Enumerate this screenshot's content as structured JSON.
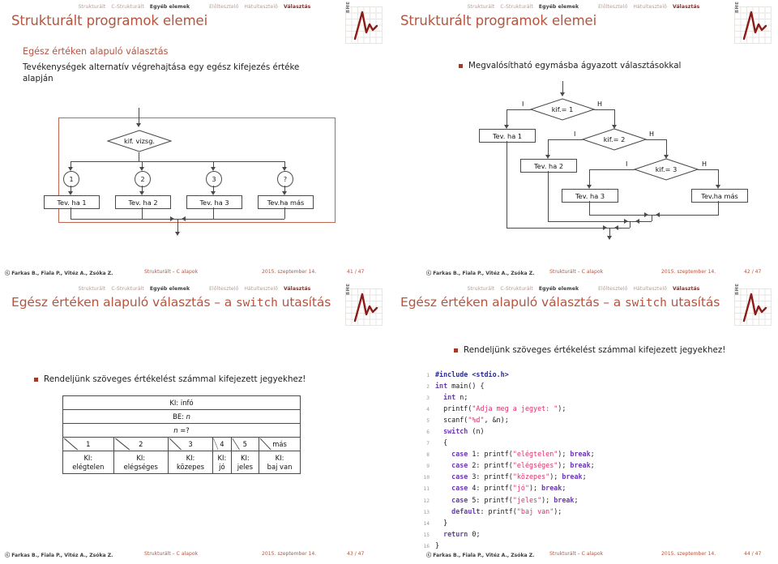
{
  "nav": {
    "group1": [
      {
        "label": "Strukturált",
        "state": "dim"
      },
      {
        "label": "C-Strukturált",
        "state": "dim"
      },
      {
        "label": "Egyéb elemek",
        "state": "active"
      }
    ],
    "group2": [
      {
        "label": "Előltesztelő",
        "state": "dim"
      },
      {
        "label": "Hátultesztelő",
        "state": "dim"
      },
      {
        "label": "Választás",
        "state": "active2"
      }
    ]
  },
  "logo": {
    "text": "BME"
  },
  "slides": [
    {
      "title": "Strukturált programok elemei",
      "frametitle": "Egész értéken alapuló választás",
      "paragraph": "Tevékenységek alternatív végrehajtása egy egész kifejezés értéke alapján",
      "flowchart": {
        "decision": "kif. vizsg.",
        "branches": [
          "1",
          "2",
          "3",
          "?"
        ],
        "actions": [
          "Tev. ha 1",
          "Tev. ha 2",
          "Tev. ha 3",
          "Tev.ha más"
        ]
      },
      "footer": {
        "authors": "ⓒ Farkas B., Fiala P., Vitéz A., Zsóka Z.",
        "course": "Strukturált – C alapok",
        "date": "2015. szeptember 14.",
        "page": "41 / 47"
      }
    },
    {
      "title": "Strukturált programok elemei",
      "bullet": "Megvalósítható egymásba ágyazott választásokkal",
      "flowchart": {
        "decisions": [
          "kif.= 1",
          "kif.= 2",
          "kif.= 3"
        ],
        "true_label": "I",
        "false_label": "H",
        "actions": [
          "Tev. ha 1",
          "Tev. ha 2",
          "Tev. ha 3",
          "Tev.ha más"
        ]
      },
      "footer": {
        "authors": "ⓒ Farkas B., Fiala P., Vitéz A., Zsóka Z.",
        "course": "Strukturált – C alapok",
        "date": "2015. szeptember 14.",
        "page": "42 / 47"
      }
    },
    {
      "title_plain": "Egész értéken alapuló választás – a ",
      "title_mono": "switch",
      "title_tail": " utasítás",
      "bullet": "Rendeljünk szöveges értékelést számmal kifejezett jegyekhez!",
      "table": {
        "row_out": "KI: infó",
        "row_in_prefix": "BE: ",
        "row_in_var": "n",
        "row_sel_var": "n",
        "row_sel_rest": " =?",
        "cases": [
          "1",
          "2",
          "3",
          "4",
          "5",
          "más"
        ],
        "outputs": [
          {
            "k": "KI:",
            "v": "elégtelen"
          },
          {
            "k": "KI:",
            "v": "elégséges"
          },
          {
            "k": "KI:",
            "v": "közepes"
          },
          {
            "k": "KI:",
            "v": "jó"
          },
          {
            "k": "KI:",
            "v": "jeles"
          },
          {
            "k": "KI:",
            "v": "baj van"
          }
        ]
      },
      "footer": {
        "authors": "ⓒ Farkas B., Fiala P., Vitéz A., Zsóka Z.",
        "course": "Strukturált – C alapok",
        "date": "2015. szeptember 14.",
        "page": "43 / 47"
      }
    },
    {
      "title_plain": "Egész értéken alapuló választás – a ",
      "title_mono": "switch",
      "title_tail": " utasítás",
      "bullet": "Rendeljünk szöveges értékelést számmal kifejezett jegyekhez!",
      "code": [
        {
          "n": "1",
          "parts": [
            {
              "t": "#include ",
              "c": "pp"
            },
            {
              "t": "<stdio.h>",
              "c": "pp"
            }
          ]
        },
        {
          "n": "2",
          "parts": [
            {
              "t": "int",
              "c": "kw"
            },
            {
              "t": " main() {",
              "c": "pl"
            }
          ]
        },
        {
          "n": "3",
          "parts": [
            {
              "t": "  ",
              "c": "pl"
            },
            {
              "t": "int",
              "c": "kw"
            },
            {
              "t": " n;",
              "c": "pl"
            }
          ]
        },
        {
          "n": "4",
          "parts": [
            {
              "t": "  printf(",
              "c": "pl"
            },
            {
              "t": "\"Adja meg a jegyet: \"",
              "c": "str"
            },
            {
              "t": ");",
              "c": "pl"
            }
          ]
        },
        {
          "n": "5",
          "parts": [
            {
              "t": "  scanf(",
              "c": "pl"
            },
            {
              "t": "\"%d\"",
              "c": "str"
            },
            {
              "t": ", &n);",
              "c": "pl"
            }
          ]
        },
        {
          "n": "6",
          "parts": [
            {
              "t": "  ",
              "c": "pl"
            },
            {
              "t": "switch",
              "c": "kw"
            },
            {
              "t": " (n)",
              "c": "pl"
            }
          ]
        },
        {
          "n": "7",
          "parts": [
            {
              "t": "  {",
              "c": "pl"
            }
          ]
        },
        {
          "n": "8",
          "parts": [
            {
              "t": "    ",
              "c": "pl"
            },
            {
              "t": "case",
              "c": "kw"
            },
            {
              "t": " 1: printf(",
              "c": "pl"
            },
            {
              "t": "\"elégtelen\"",
              "c": "str"
            },
            {
              "t": "); ",
              "c": "pl"
            },
            {
              "t": "break",
              "c": "kw"
            },
            {
              "t": ";",
              "c": "pl"
            }
          ]
        },
        {
          "n": "9",
          "parts": [
            {
              "t": "    ",
              "c": "pl"
            },
            {
              "t": "case",
              "c": "kw"
            },
            {
              "t": " 2: printf(",
              "c": "pl"
            },
            {
              "t": "\"elégséges\"",
              "c": "str"
            },
            {
              "t": "); ",
              "c": "pl"
            },
            {
              "t": "break",
              "c": "kw"
            },
            {
              "t": ";",
              "c": "pl"
            }
          ]
        },
        {
          "n": "10",
          "parts": [
            {
              "t": "    ",
              "c": "pl"
            },
            {
              "t": "case",
              "c": "kw"
            },
            {
              "t": " 3: printf(",
              "c": "pl"
            },
            {
              "t": "\"közepes\"",
              "c": "str"
            },
            {
              "t": "); ",
              "c": "pl"
            },
            {
              "t": "break",
              "c": "kw"
            },
            {
              "t": ";",
              "c": "pl"
            }
          ]
        },
        {
          "n": "11",
          "parts": [
            {
              "t": "    ",
              "c": "pl"
            },
            {
              "t": "case",
              "c": "kw"
            },
            {
              "t": " 4: printf(",
              "c": "pl"
            },
            {
              "t": "\"jó\"",
              "c": "str"
            },
            {
              "t": "); ",
              "c": "pl"
            },
            {
              "t": "break",
              "c": "kw"
            },
            {
              "t": ";",
              "c": "pl"
            }
          ]
        },
        {
          "n": "12",
          "parts": [
            {
              "t": "    ",
              "c": "pl"
            },
            {
              "t": "case",
              "c": "kw"
            },
            {
              "t": " 5: printf(",
              "c": "pl"
            },
            {
              "t": "\"jeles\"",
              "c": "str"
            },
            {
              "t": "); ",
              "c": "pl"
            },
            {
              "t": "break",
              "c": "kw"
            },
            {
              "t": ";",
              "c": "pl"
            }
          ]
        },
        {
          "n": "13",
          "parts": [
            {
              "t": "    ",
              "c": "pl"
            },
            {
              "t": "default",
              "c": "kw"
            },
            {
              "t": ": printf(",
              "c": "pl"
            },
            {
              "t": "\"baj van\"",
              "c": "str"
            },
            {
              "t": ");",
              "c": "pl"
            }
          ]
        },
        {
          "n": "14",
          "parts": [
            {
              "t": "  }",
              "c": "pl"
            }
          ]
        },
        {
          "n": "15",
          "parts": [
            {
              "t": "  ",
              "c": "pl"
            },
            {
              "t": "return",
              "c": "kw"
            },
            {
              "t": " 0;",
              "c": "pl"
            }
          ]
        },
        {
          "n": "16",
          "parts": [
            {
              "t": "}",
              "c": "pl"
            }
          ]
        }
      ],
      "footer": {
        "authors": "ⓒ Farkas B., Fiala P., Vitéz A., Zsóka Z.",
        "course": "Strukturált – C alapok",
        "date": "2015. szeptember 14.",
        "page": "44 / 47"
      }
    }
  ],
  "colors": {
    "accent": "#b5543f",
    "bullet": "#9e3b2c",
    "nav_dim": "#b79a95",
    "line": "#4a4a4a",
    "red_frame": "#c0654f",
    "code_keyword": "#6a3ab2",
    "code_string": "#d6336c",
    "code_preproc": "#2b2b8f"
  }
}
